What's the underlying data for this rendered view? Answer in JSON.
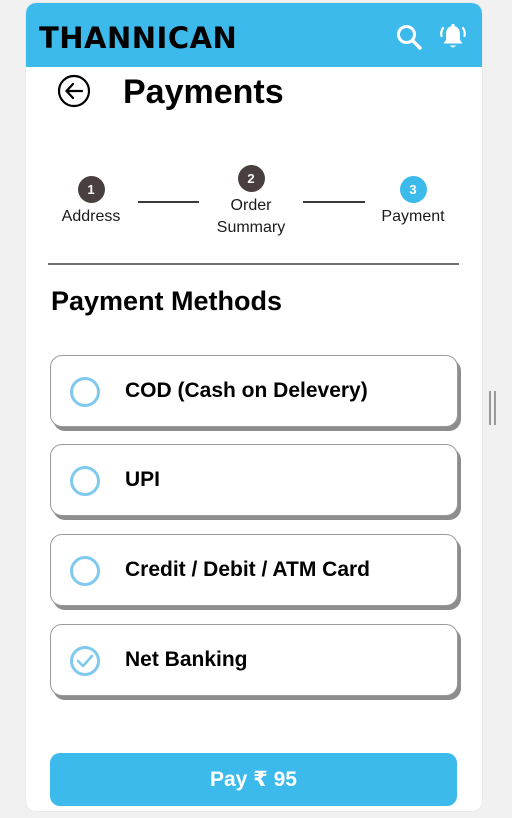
{
  "app": {
    "brand": "THANNICAN"
  },
  "header": {
    "title": "Payments"
  },
  "icons": {
    "search": "search-icon",
    "notifications": "bell-icon",
    "back": "back-arrow-icon"
  },
  "steps": [
    {
      "number": "1",
      "label": "Address",
      "state": "done"
    },
    {
      "number": "2",
      "label": "Order Summary",
      "state": "done"
    },
    {
      "number": "3",
      "label": "Payment",
      "state": "active"
    }
  ],
  "section": {
    "title": "Payment Methods"
  },
  "methods": [
    {
      "label": "COD (Cash on Delevery)",
      "selected": false
    },
    {
      "label": "UPI",
      "selected": false
    },
    {
      "label": "Credit / Debit / ATM Card",
      "selected": false
    },
    {
      "label": "Net Banking",
      "selected": true
    }
  ],
  "pay_button": {
    "label": "Pay ₹ 95"
  },
  "colors": {
    "accent": "#3dbaec",
    "step_done": "#4a3f3f",
    "step_active": "#3dbaec",
    "radio_border": "#7fc9ee"
  }
}
